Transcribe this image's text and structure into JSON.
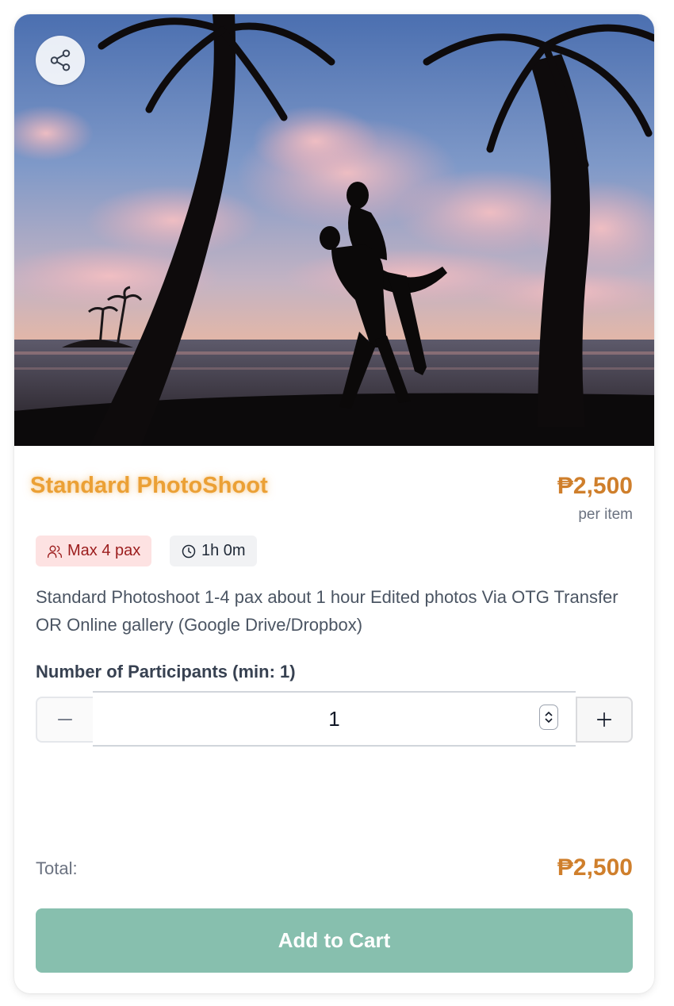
{
  "product": {
    "title": "Standard PhotoShoot",
    "price": "₱2,500",
    "price_unit": "per item",
    "badges": {
      "max_pax": "Max 4 pax",
      "duration": "1h 0m"
    },
    "description": "Standard Photoshoot 1-4 pax about 1 hour Edited photos Via OTG Transfer OR Online gallery (Google Drive/Dropbox)"
  },
  "participants": {
    "label": "Number of Participants (min: 1)",
    "value": "1"
  },
  "total": {
    "label": "Total:",
    "value": "₱2,500"
  },
  "actions": {
    "add_to_cart": "Add to Cart"
  },
  "colors": {
    "title": "#eba035",
    "price": "#cf7f2c",
    "cart_button": "#87bfae",
    "pax_badge_bg": "#fde2e2",
    "pax_badge_text": "#9b1c1c"
  },
  "icons": {
    "share": "share-icon",
    "people": "users-icon",
    "clock": "clock-icon",
    "minus": "minus-icon",
    "plus": "plus-icon"
  }
}
